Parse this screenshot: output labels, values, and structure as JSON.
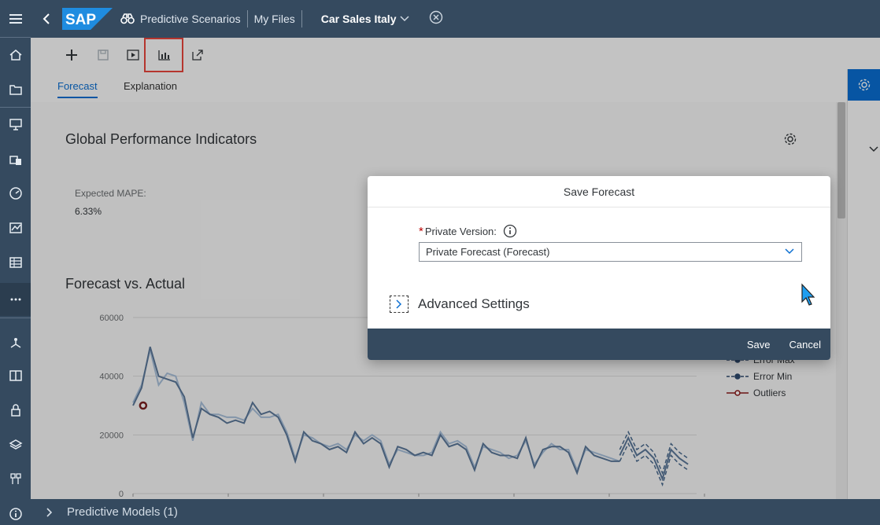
{
  "shell": {
    "app_name": "Predictive Scenarios",
    "crumb_files": "My Files",
    "scenario_title": "Car Sales Italy"
  },
  "logo_text": "SAP",
  "tabs": [
    {
      "label": "Forecast",
      "active": true
    },
    {
      "label": "Explanation",
      "active": false
    }
  ],
  "sections": {
    "gpi_title": "Global Performance Indicators",
    "mape_label": "Expected MAPE:",
    "mape_value": "6.33%",
    "fva_title": "Forecast vs. Actual"
  },
  "chart_data": {
    "type": "line",
    "ylim": [
      0,
      60000
    ],
    "y_ticks": [
      "60000",
      "40000",
      "20000",
      "0"
    ],
    "legend": [
      "Error Max",
      "Error Min",
      "Outliers"
    ],
    "series": [
      {
        "values": [
          30000,
          36000,
          50000,
          40000,
          39000,
          38000,
          33000,
          19000,
          29000,
          27000,
          26000,
          24000,
          25000,
          24000,
          31000,
          27000,
          28000,
          26000,
          20000,
          11000,
          21000,
          18000,
          17000,
          15000,
          16000,
          14000,
          21000,
          17000,
          19000,
          17000,
          9000,
          16000,
          15000,
          13000,
          14000,
          13000,
          20000,
          16000,
          17000,
          15000,
          8000,
          17000,
          14000,
          13000,
          13000,
          12000,
          19000,
          9000,
          15000,
          16000,
          16000,
          14000,
          7000,
          16000,
          13000,
          12000,
          11000,
          11000
        ]
      },
      {
        "values": [
          31000,
          37000,
          49000,
          37000,
          41000,
          40000,
          31000,
          18000,
          31000,
          27000,
          27000,
          26000,
          26000,
          25000,
          29000,
          26000,
          26000,
          27000,
          21000,
          12000,
          20000,
          19000,
          17000,
          16000,
          17000,
          15000,
          20000,
          18000,
          20000,
          18000,
          10000,
          15000,
          14000,
          13000,
          13000,
          14000,
          21000,
          17000,
          18000,
          16000,
          9000,
          16000,
          15000,
          14000,
          12000,
          13000,
          18000,
          10000,
          14000,
          17000,
          15000,
          15000,
          8000,
          15000,
          14000,
          13000,
          12000,
          11000
        ]
      }
    ],
    "forecast": {
      "center": [
        13000,
        19000,
        13000,
        15000,
        12000,
        5000,
        15000,
        12000,
        10000
      ],
      "upper": [
        15000,
        21000,
        15000,
        17000,
        14000,
        7000,
        17000,
        14000,
        12000
      ],
      "lower": [
        11000,
        17000,
        11000,
        13000,
        10000,
        3000,
        13000,
        10000,
        8000
      ]
    },
    "outlier_index": 1,
    "outlier_value": 30000
  },
  "dialog": {
    "title": "Save Forecast",
    "field_label": "Private Version:",
    "field_value": "Private Forecast (Forecast)",
    "advanced": "Advanced Settings",
    "save": "Save",
    "cancel": "Cancel"
  },
  "bottom_bar": "Predictive Models (1)",
  "colors": {
    "shell": "#354a5f",
    "accent": "#0a6ed1",
    "highlight": "#e8453c"
  }
}
